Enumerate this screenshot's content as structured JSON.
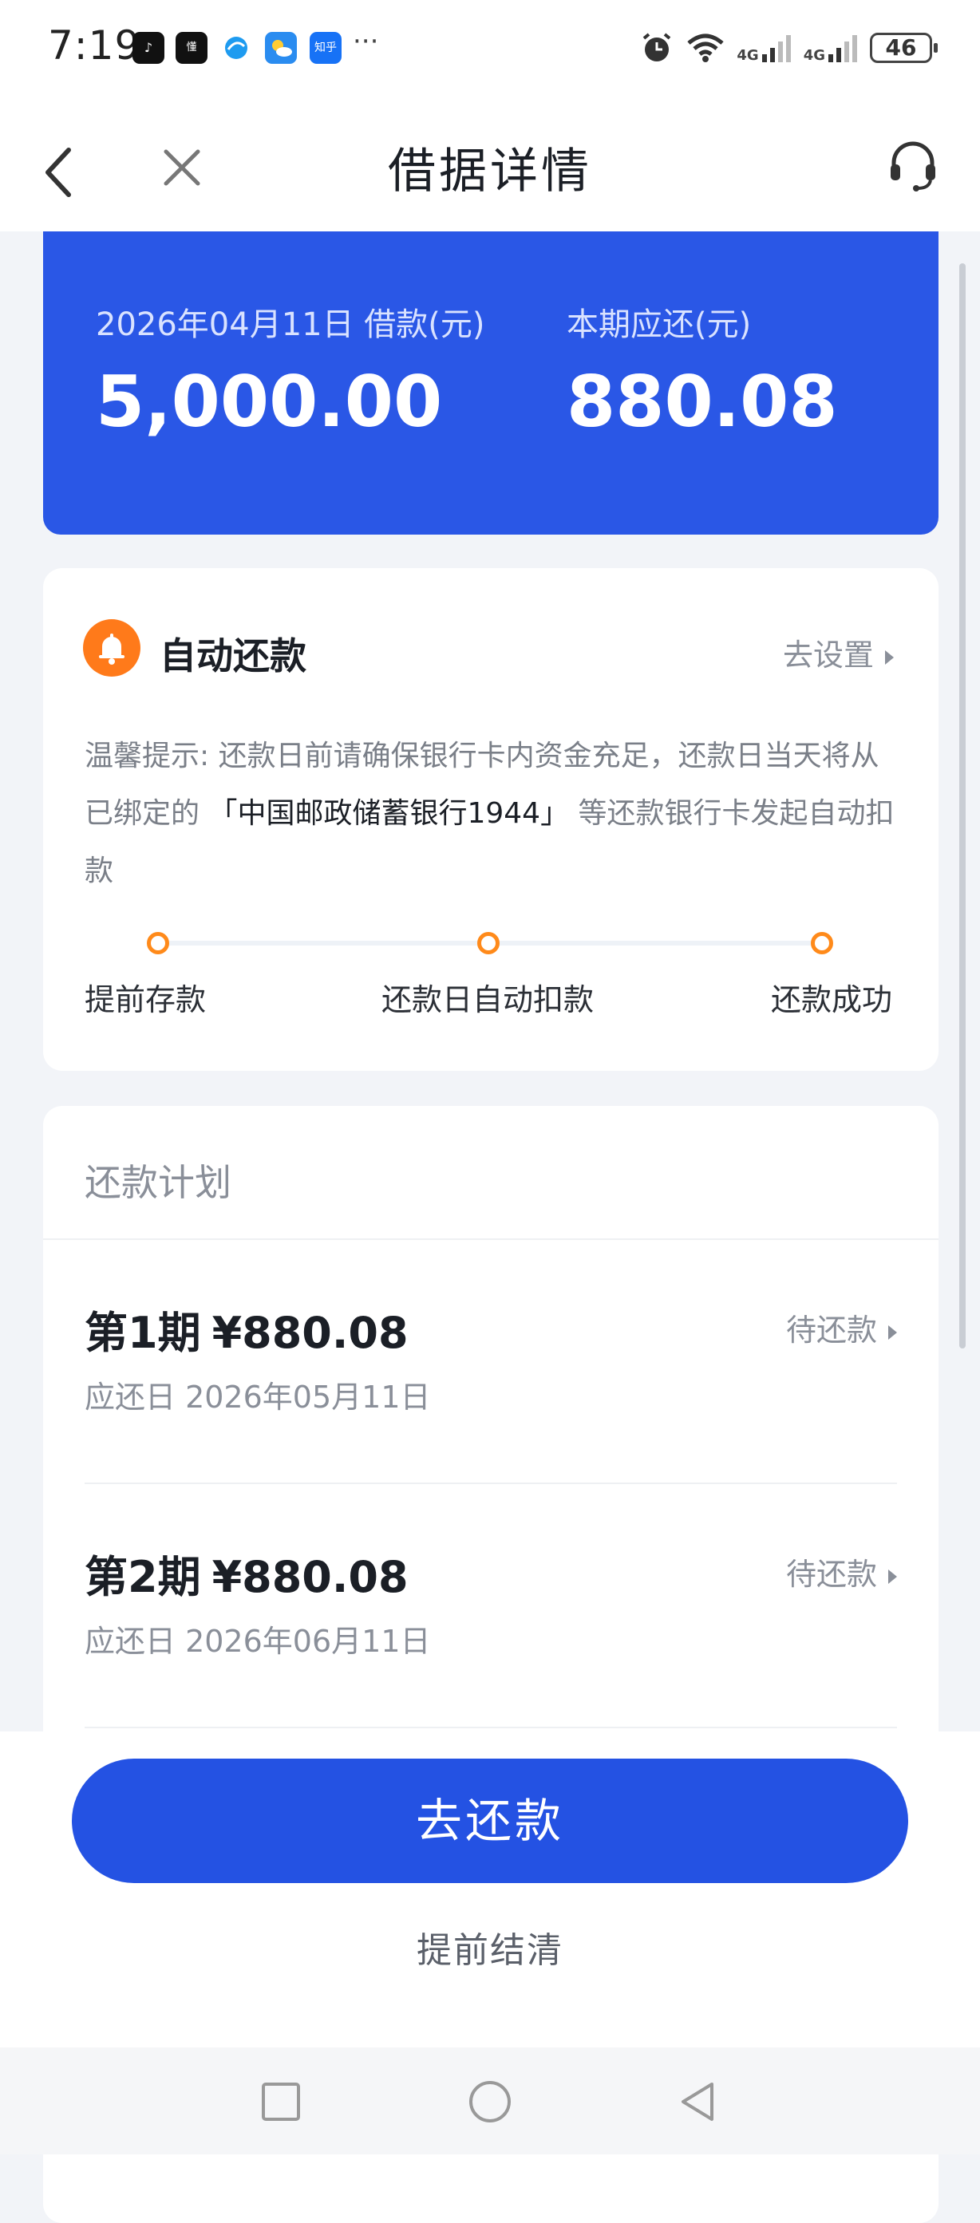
{
  "status_bar": {
    "time": "7:19",
    "apps": [
      "抖音",
      "懂",
      "视频",
      "天气",
      "知乎"
    ],
    "signal1": "4G",
    "signal2": "4G",
    "battery": "46"
  },
  "nav": {
    "title": "借据详情"
  },
  "loan": {
    "loan_label": "2026年04月11日 借款(元)",
    "loan_amount": "5,000.00",
    "due_label": "本期应还(元)",
    "due_amount": "880.08"
  },
  "autopay": {
    "title": "自动还款",
    "setting_link": "去设置",
    "tip_prefix": "温馨提示: 还款日前请确保银行卡内资金充足，还款日当天将从已绑定的",
    "bank": "「中国邮政储蓄银行1944」",
    "tip_suffix": "等还款银行卡发起自动扣款",
    "steps": [
      "提前存款",
      "还款日自动扣款",
      "还款成功"
    ]
  },
  "plan": {
    "title": "还款计划",
    "items": [
      {
        "period": "第1期",
        "amount": "¥880.08",
        "due_date": "应还日 2026年05月11日",
        "status": "待还款"
      },
      {
        "period": "第2期",
        "amount": "¥880.08",
        "due_date": "应还日 2026年06月11日",
        "status": "待还款"
      }
    ]
  },
  "actions": {
    "pay_button": "去还款",
    "settle_link": "提前结清"
  },
  "colors": {
    "primary": "#2a57e6",
    "accent_orange": "#ff7a1a",
    "muted_text": "#8a8f99"
  },
  "icons": {
    "back": "chevron-left-icon",
    "close": "close-icon",
    "service": "headset-icon",
    "bell": "bell-icon"
  }
}
